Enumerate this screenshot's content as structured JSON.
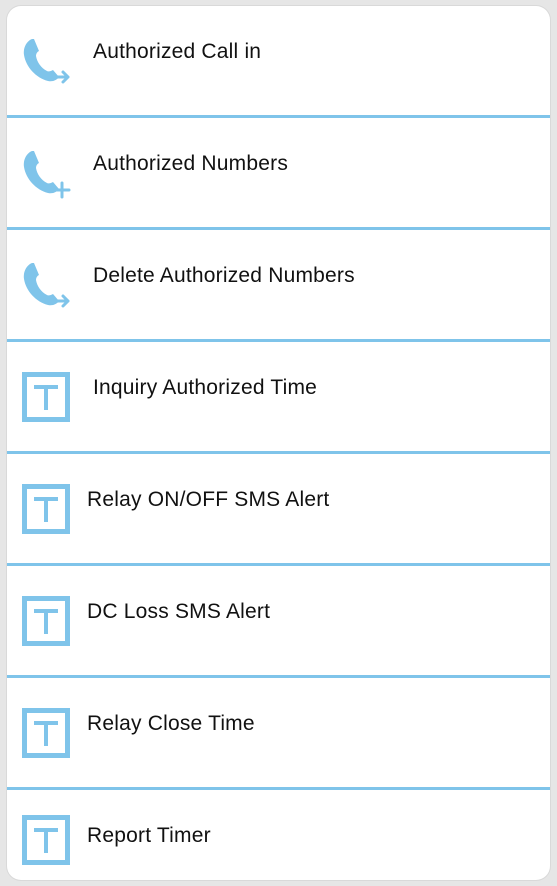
{
  "menu": {
    "items": [
      {
        "label": "Authorized Call in",
        "icon": "phone-arrow-icon"
      },
      {
        "label": "Authorized Numbers",
        "icon": "phone-plus-icon"
      },
      {
        "label": "Delete Authorized Numbers",
        "icon": "phone-arrow-icon"
      },
      {
        "label": "Inquiry Authorized Time",
        "icon": "t-box-icon"
      },
      {
        "label": "Relay ON/OFF SMS Alert",
        "icon": "t-box-icon"
      },
      {
        "label": "DC Loss SMS Alert",
        "icon": "t-box-icon"
      },
      {
        "label": "Relay Close Time",
        "icon": "t-box-icon"
      },
      {
        "label": "Report Timer",
        "icon": "t-box-icon"
      }
    ]
  },
  "colors": {
    "accent": "#7fc4ea",
    "background": "#e6e6e6",
    "card": "#ffffff",
    "text": "#111111"
  }
}
